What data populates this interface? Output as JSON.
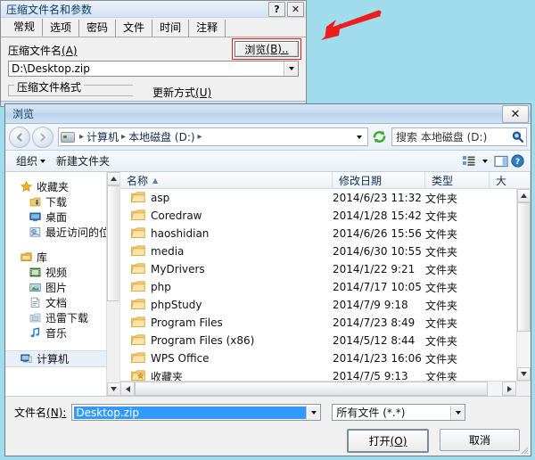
{
  "winrar": {
    "title": "压缩文件名和参数",
    "titlebar_buttons": [
      {
        "name": "help",
        "glyph": "?"
      },
      {
        "name": "close",
        "glyph": "✕"
      }
    ],
    "tabs": [
      {
        "label": "常规",
        "active": true
      },
      {
        "label": "选项",
        "active": false
      },
      {
        "label": "密码",
        "active": false
      },
      {
        "label": "文件",
        "active": false
      },
      {
        "label": "时间",
        "active": false
      },
      {
        "label": "注释",
        "active": false
      }
    ],
    "archive_name_label": "压缩文件名",
    "archive_name_accel": "(A)",
    "archive_name_value": "D:\\Desktop.zip",
    "browse_button": "浏览",
    "browse_button_accel": "(B)..",
    "group_format_label": "压缩文件格式",
    "update_mode_label": "更新方式",
    "update_mode_accel": "(U)"
  },
  "annotation": {
    "type": "arrow",
    "color": "#ee1c1c",
    "points_to": "browse-button"
  },
  "browse_dialog": {
    "title": "浏览",
    "close_glyph": "✕",
    "nav": {
      "back_tooltip": "back",
      "forward_tooltip": "forward",
      "breadcrumb": [
        "计算机",
        "本地磁盘 (D:)"
      ],
      "breadcrumb_separator": "▸",
      "refresh_icon": "refresh-icon",
      "search_placeholder": "搜索 本地磁盘 (D:)",
      "search_value": ""
    },
    "toolbar": {
      "organize": "组织",
      "new_folder": "新建文件夹",
      "view_icon": "view-list-icon",
      "preview_icon": "preview-pane-icon",
      "help_icon": "help-icon"
    },
    "navpane": [
      {
        "label": "收藏夹",
        "icon": "star-icon",
        "level": 0,
        "selected": false
      },
      {
        "label": "下载",
        "icon": "download-icon",
        "level": 1,
        "selected": false
      },
      {
        "label": "桌面",
        "icon": "desktop-icon",
        "level": 1,
        "selected": false
      },
      {
        "label": "最近访问的位置",
        "icon": "recent-places-icon",
        "level": 1,
        "selected": false
      },
      {
        "label": "",
        "icon": "gap",
        "level": 0,
        "selected": false
      },
      {
        "label": "库",
        "icon": "library-icon",
        "level": 0,
        "selected": false
      },
      {
        "label": "视频",
        "icon": "video-icon",
        "level": 1,
        "selected": false
      },
      {
        "label": "图片",
        "icon": "picture-icon",
        "level": 1,
        "selected": false
      },
      {
        "label": "文档",
        "icon": "document-icon",
        "level": 1,
        "selected": false
      },
      {
        "label": "迅雷下载",
        "icon": "thunder-download-icon",
        "level": 1,
        "selected": false
      },
      {
        "label": "音乐",
        "icon": "music-icon",
        "level": 1,
        "selected": false
      },
      {
        "label": "",
        "icon": "gap",
        "level": 0,
        "selected": false
      },
      {
        "label": "计算机",
        "icon": "computer-icon",
        "level": 0,
        "selected": true
      }
    ],
    "columns": [
      {
        "key": "name",
        "label": "名称",
        "sorted": true,
        "sort_dir": "asc"
      },
      {
        "key": "date",
        "label": "修改日期",
        "sorted": false
      },
      {
        "key": "type",
        "label": "类型",
        "sorted": false
      },
      {
        "key": "size",
        "label": "大",
        "sorted": false
      }
    ],
    "files": [
      {
        "name": "asp",
        "date": "2014/6/23 11:32",
        "type": "文件夹",
        "icon": "folder-icon"
      },
      {
        "name": "Coredraw",
        "date": "2014/1/28 15:42",
        "type": "文件夹",
        "icon": "folder-icon"
      },
      {
        "name": "haoshidian",
        "date": "2014/6/26 15:56",
        "type": "文件夹",
        "icon": "folder-icon"
      },
      {
        "name": "media",
        "date": "2014/6/30 10:55",
        "type": "文件夹",
        "icon": "folder-icon"
      },
      {
        "name": "MyDrivers",
        "date": "2014/1/22 9:21",
        "type": "文件夹",
        "icon": "folder-icon"
      },
      {
        "name": "php",
        "date": "2014/7/17 10:05",
        "type": "文件夹",
        "icon": "folder-icon"
      },
      {
        "name": "phpStudy",
        "date": "2014/7/9 9:18",
        "type": "文件夹",
        "icon": "folder-icon"
      },
      {
        "name": "Program Files",
        "date": "2014/7/23 8:49",
        "type": "文件夹",
        "icon": "folder-icon"
      },
      {
        "name": "Program Files (x86)",
        "date": "2014/5/12 8:44",
        "type": "文件夹",
        "icon": "folder-icon"
      },
      {
        "name": "WPS Office",
        "date": "2014/1/23 16:06",
        "type": "文件夹",
        "icon": "folder-icon"
      },
      {
        "name": "收藏夹",
        "date": "2014/7/5 9:13",
        "type": "文件夹",
        "icon": "folder-favorites-icon"
      }
    ],
    "footer": {
      "filename_label": "文件名",
      "filename_accel": "(N):",
      "filename_value": "Desktop.zip",
      "filter_value": "所有文件 (*.*)",
      "open_button": "打开",
      "open_button_accel": "(O)",
      "cancel_button": "取消"
    }
  },
  "colors": {
    "desktop": "#9fdcec",
    "highlight_red": "#e02020",
    "selection_blue": "#3399ff",
    "title_blue": "#14375a"
  }
}
